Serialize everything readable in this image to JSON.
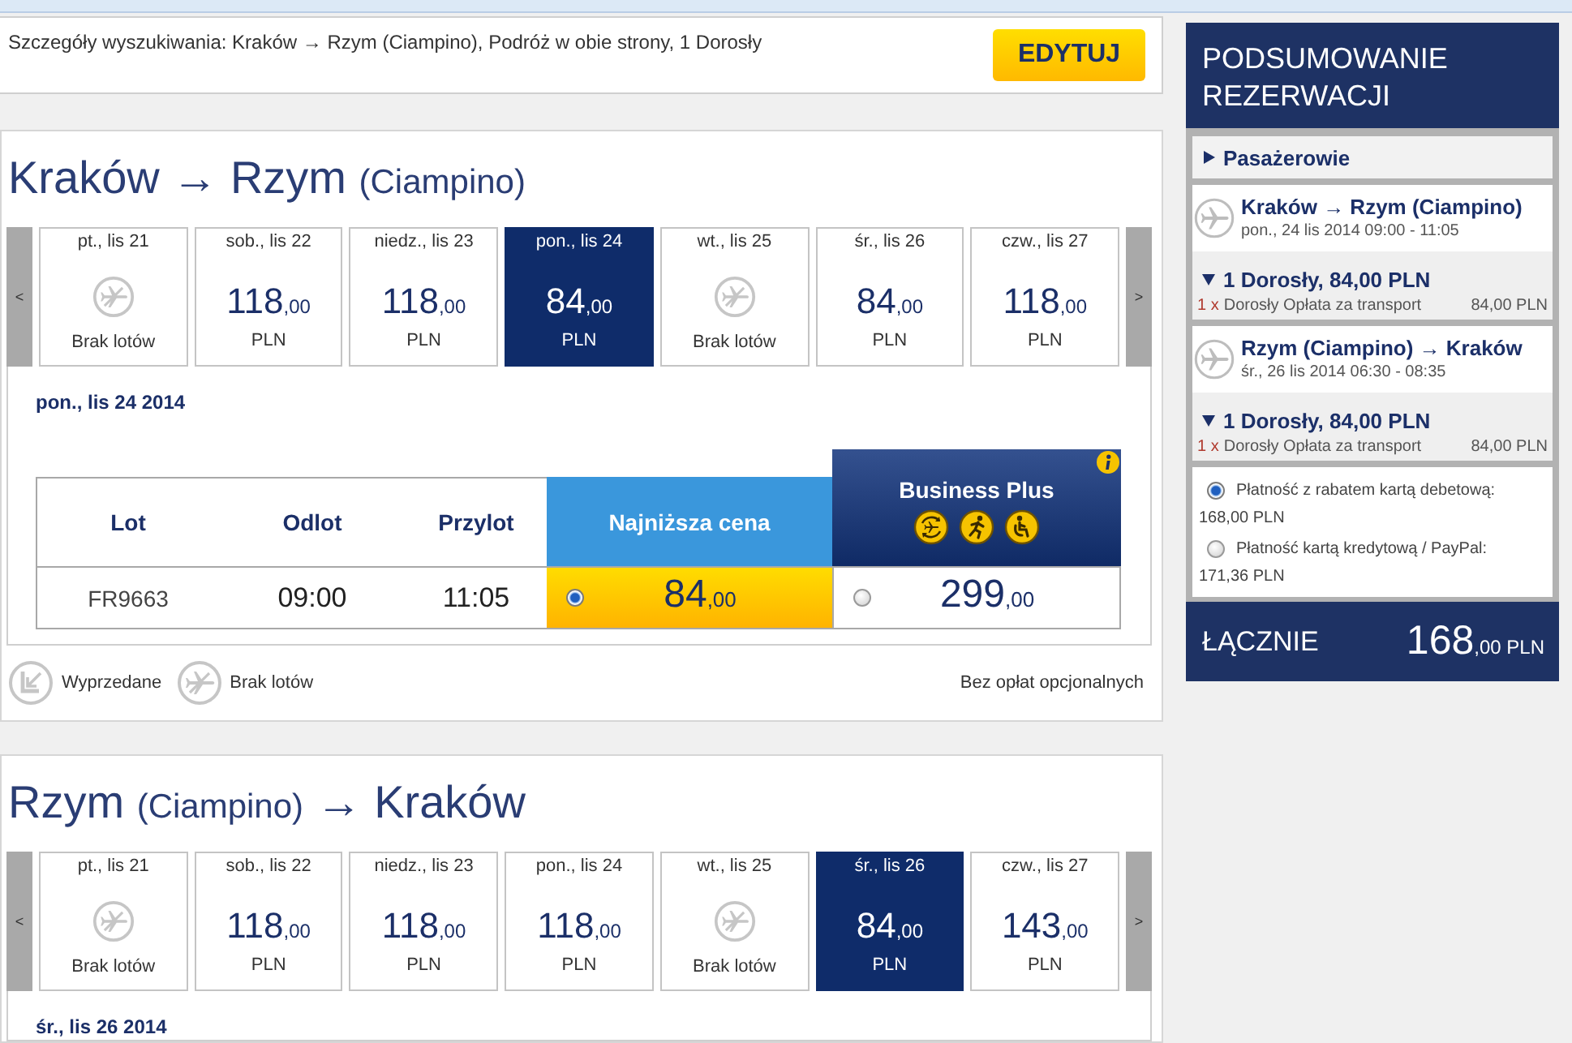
{
  "search_summary": {
    "text": "Szczegóły wyszukiwania: Kraków → Rzym (Ciampino), Podróż w obie strony, 1 Dorosły",
    "edit_button": "EDYTUJ"
  },
  "journeys": [
    {
      "title_parts": [
        {
          "kind": "city",
          "text": "Kraków"
        },
        {
          "kind": "arrow",
          "text": "→"
        },
        {
          "kind": "city",
          "text": "Rzym"
        },
        {
          "kind": "airport",
          "text": "(Ciampino)"
        }
      ],
      "prev_button": "<",
      "next_button": ">",
      "days": [
        {
          "kind": "no-flights",
          "label": "pt., lis 21",
          "status": "Brak lotów",
          "selected": false
        },
        {
          "kind": "fare",
          "label": "sob., lis 22",
          "price": "118",
          "decimals": ",00",
          "currency": "PLN",
          "selected": false
        },
        {
          "kind": "fare",
          "label": "niedz., lis 23",
          "price": "118",
          "decimals": ",00",
          "currency": "PLN",
          "selected": false
        },
        {
          "kind": "fare",
          "label": "pon., lis 24",
          "price": "84",
          "decimals": ",00",
          "currency": "PLN",
          "selected": true
        },
        {
          "kind": "no-flights",
          "label": "wt., lis 25",
          "status": "Brak lotów",
          "selected": false
        },
        {
          "kind": "fare",
          "label": "śr., lis 26",
          "price": "84",
          "decimals": ",00",
          "currency": "PLN",
          "selected": false
        },
        {
          "kind": "fare",
          "label": "czw., lis 27",
          "price": "118",
          "decimals": ",00",
          "currency": "PLN",
          "selected": false
        }
      ],
      "date_heading": "pon., lis 24 2014",
      "fares_table": {
        "columns": [
          "Lot",
          "Odlot",
          "Przylot"
        ],
        "fare_columns": [
          {
            "kind": "standard",
            "label": "Najniższa cena"
          },
          {
            "kind": "business",
            "label": "Business Plus"
          }
        ],
        "rows": [
          {
            "flight": "FR9663",
            "departure": "09:00",
            "arrival": "11:05",
            "fares": [
              {
                "price": "84",
                "decimals": ",00",
                "selected": true
              },
              {
                "price": "299",
                "decimals": ",00",
                "selected": false
              }
            ]
          }
        ]
      },
      "legend": [
        {
          "kind": "sold-out",
          "label": "Wyprzedane"
        },
        {
          "kind": "no-flights",
          "label": "Brak lotów"
        }
      ],
      "note": "Bez opłat opcjonalnych"
    },
    {
      "title_parts": [
        {
          "kind": "city",
          "text": "Rzym"
        },
        {
          "kind": "airport",
          "text": "(Ciampino)"
        },
        {
          "kind": "arrow",
          "text": "→"
        },
        {
          "kind": "city",
          "text": "Kraków"
        }
      ],
      "prev_button": "<",
      "next_button": ">",
      "days": [
        {
          "kind": "no-flights",
          "label": "pt., lis 21",
          "status": "Brak lotów",
          "selected": false
        },
        {
          "kind": "fare",
          "label": "sob., lis 22",
          "price": "118",
          "decimals": ",00",
          "currency": "PLN",
          "selected": false
        },
        {
          "kind": "fare",
          "label": "niedz., lis 23",
          "price": "118",
          "decimals": ",00",
          "currency": "PLN",
          "selected": false
        },
        {
          "kind": "fare",
          "label": "pon., lis 24",
          "price": "118",
          "decimals": ",00",
          "currency": "PLN",
          "selected": false
        },
        {
          "kind": "no-flights",
          "label": "wt., lis 25",
          "status": "Brak lotów",
          "selected": false
        },
        {
          "kind": "fare",
          "label": "śr., lis 26",
          "price": "84",
          "decimals": ",00",
          "currency": "PLN",
          "selected": true
        },
        {
          "kind": "fare",
          "label": "czw., lis 27",
          "price": "143",
          "decimals": ",00",
          "currency": "PLN",
          "selected": false
        }
      ],
      "date_heading": "śr., lis 26 2014"
    }
  ],
  "summary": {
    "title": "PODSUMOWANIE REZERWACJI",
    "passengers_toggle": {
      "label": "Pasażerowie",
      "expanded": false
    },
    "flights": [
      {
        "route": "Kraków → Rzym (Ciampino)",
        "schedule": "pon., 24 lis 2014 09:00 - 11:05",
        "passenger_group": {
          "label": "1 Dorosły, 84,00 PLN",
          "expanded": true,
          "lines": [
            {
              "quantity": "1 x",
              "label": "Dorosły Opłata za transport",
              "amount": "84,00 PLN"
            }
          ]
        }
      },
      {
        "route": "Rzym (Ciampino) → Kraków",
        "schedule": "śr., 26 lis 2014 06:30 - 08:35",
        "passenger_group": {
          "label": "1 Dorosły, 84,00 PLN",
          "expanded": true,
          "lines": [
            {
              "quantity": "1 x",
              "label": "Dorosły Opłata za transport",
              "amount": "84,00 PLN"
            }
          ]
        }
      }
    ],
    "payment_options": [
      {
        "label": "Płatność z rabatem kartą debetową:",
        "amount": "168,00 PLN",
        "selected": true
      },
      {
        "label": "Płatność kartą kredytową / PayPal:",
        "amount": "171,36 PLN",
        "selected": false
      }
    ],
    "total": {
      "label": "ŁĄCZNIE",
      "amount": "168",
      "decimals": ",00 PLN"
    }
  }
}
